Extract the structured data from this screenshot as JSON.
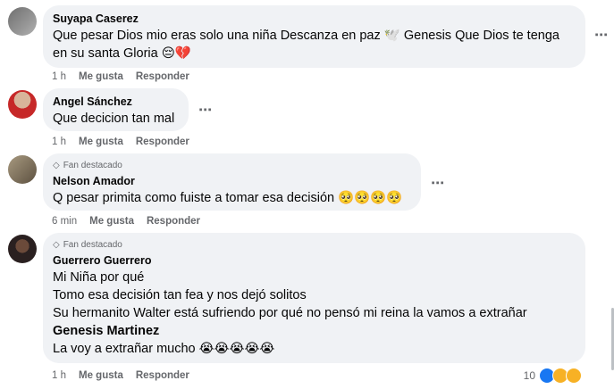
{
  "comments": [
    {
      "author": "Suyapa Caserez",
      "badge": "",
      "lines": [
        "Que pesar Dios mio eras solo una niña Descanza en paz 🕊️ Genesis Que Dios te tenga",
        "en su santa Gloria 😔💔"
      ],
      "time": "1 h",
      "like": "Me gusta",
      "reply": "Responder"
    },
    {
      "author": "Angel Sánchez",
      "badge": "",
      "lines": [
        "Que decicion tan mal"
      ],
      "time": "1 h",
      "like": "Me gusta",
      "reply": "Responder"
    },
    {
      "author": "Nelson Amador",
      "badge": "Fan destacado",
      "lines": [
        "Q pesar primita como fuiste a tomar esa decisión 🥺🥺🥺🥺"
      ],
      "time": "6 min",
      "like": "Me gusta",
      "reply": "Responder"
    },
    {
      "author": "Guerrero Guerrero",
      "badge": "Fan destacado",
      "lines": [
        "Mi Niña por qué",
        "Tomo esa decisión tan fea y nos dejó solitos",
        "Su hermanito Walter está sufriendo por qué no pensó mi reina la vamos a extrañar"
      ],
      "mention": "Genesis Martinez",
      "last_line": "La voy a extrañar mucho 😭😭😭😭😭",
      "time": "1 h",
      "like": "Me gusta",
      "reply": "Responder",
      "reaction_count": "10"
    }
  ],
  "more_icon": "⋯",
  "colors": {
    "bubble": "#f0f2f5",
    "meta": "#65676b",
    "like": "#1877f2",
    "sad": "#f7b125"
  }
}
